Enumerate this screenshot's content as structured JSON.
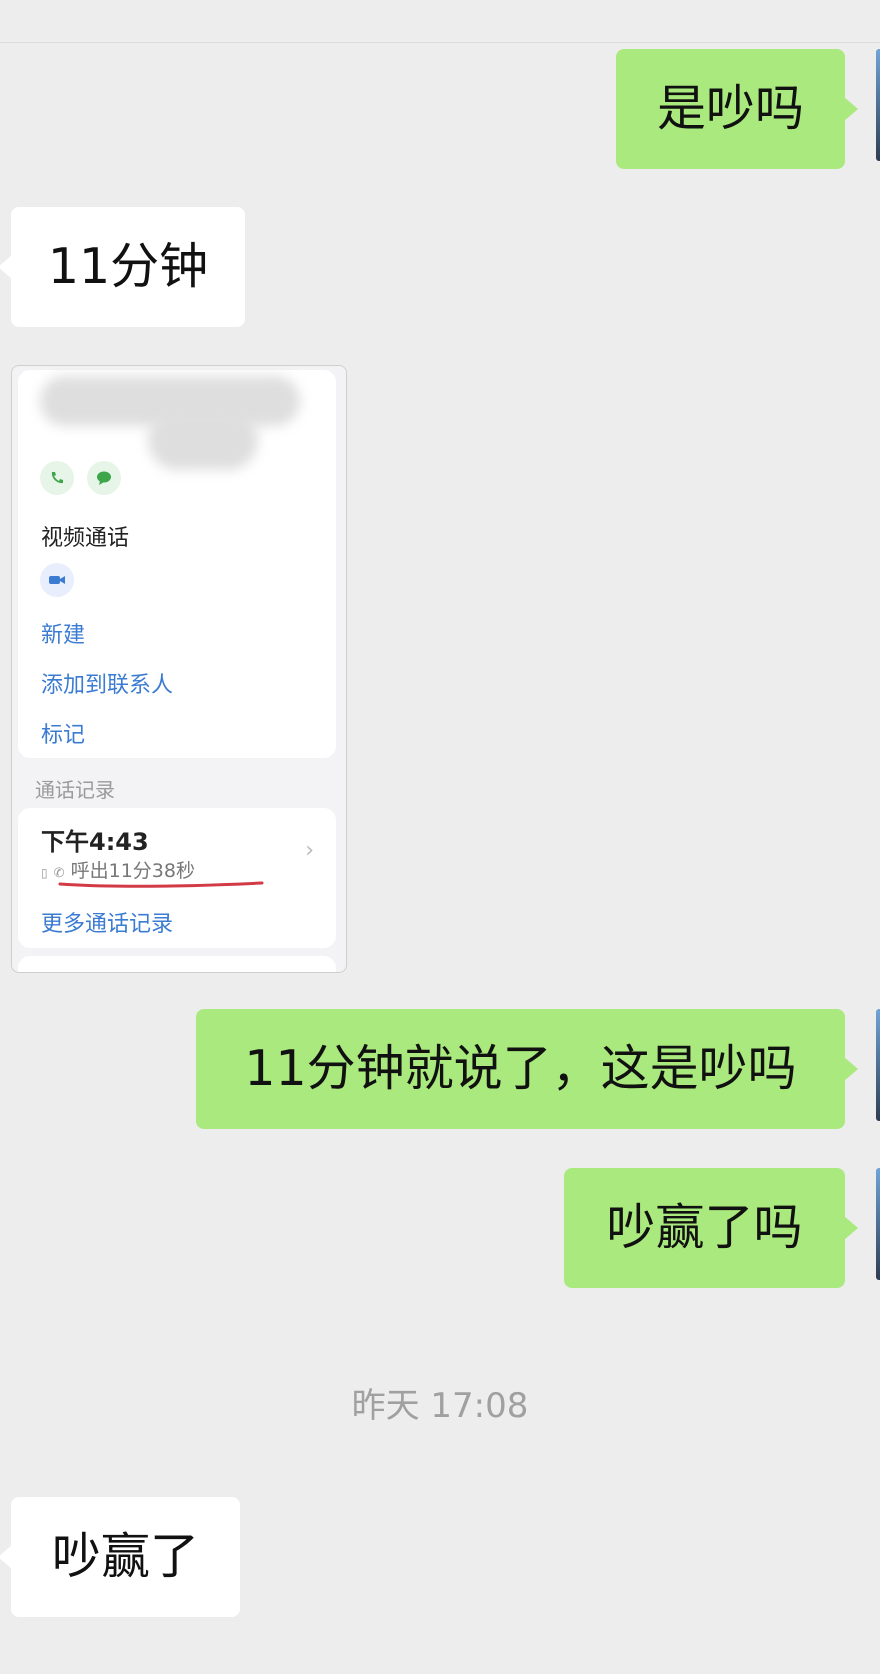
{
  "messages": [
    {
      "side": "out",
      "text": "是吵吗"
    },
    {
      "side": "in",
      "text": "11分钟"
    },
    {
      "side": "out",
      "text": "11分钟就说了，这是吵吗"
    },
    {
      "side": "out",
      "text": "吵赢了吗"
    },
    {
      "side": "in",
      "text": "吵赢了"
    }
  ],
  "timestamp": "昨天 17:08",
  "shared_screenshot": {
    "video_call_label": "视频通话",
    "actions": [
      "新建",
      "添加到联系人",
      "标记"
    ],
    "call_log_section": "通话记录",
    "call_time": "下午4:43",
    "call_detail": "呼出11分38秒",
    "more_calls": "更多通话记录",
    "icons": [
      "phone-icon",
      "message-icon",
      "video-icon",
      "chevron-right-icon"
    ]
  },
  "colors": {
    "background": "#ededed",
    "outgoing_bubble": "#a9e97d",
    "incoming_bubble": "#ffffff",
    "link_blue": "#3b7cd2",
    "underline_red": "#d23b45"
  }
}
